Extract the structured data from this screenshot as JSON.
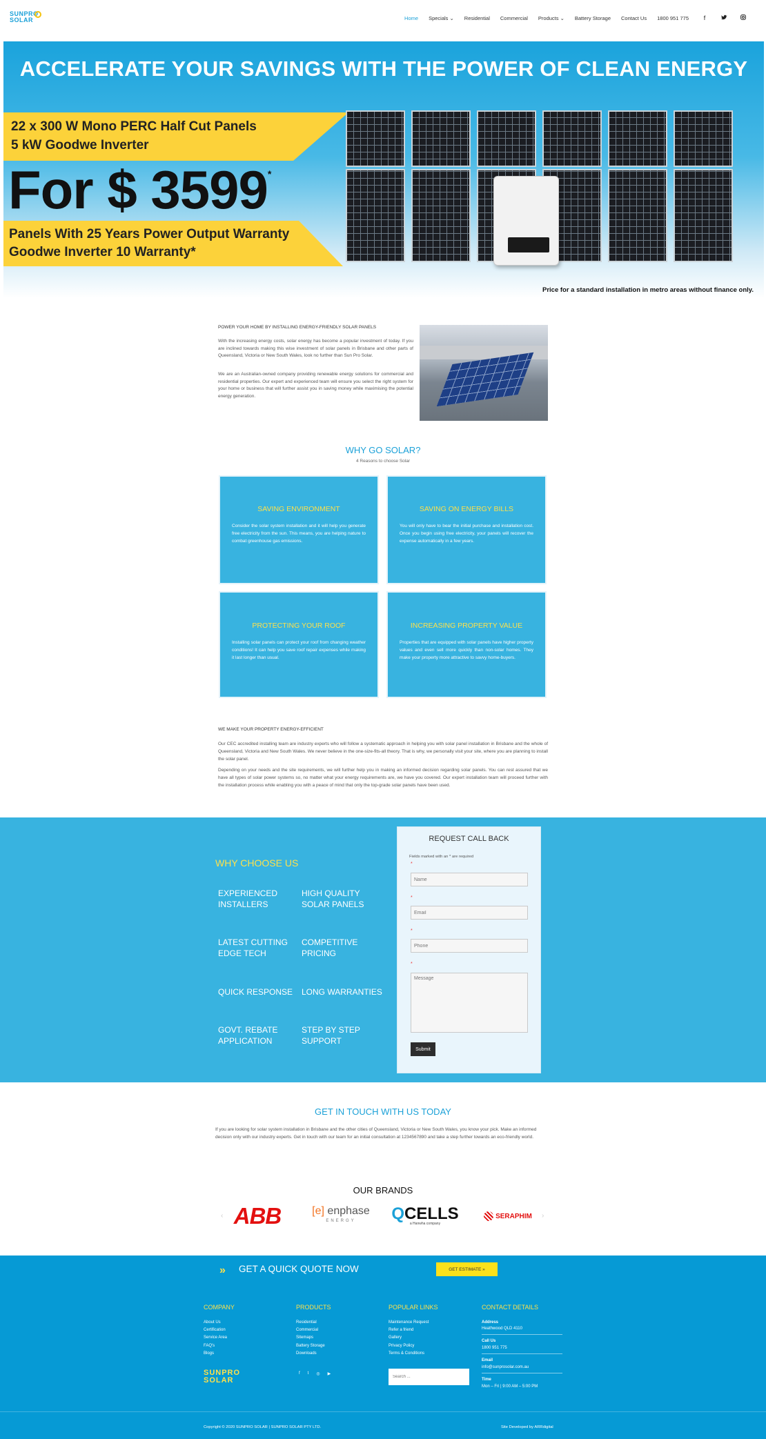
{
  "header": {
    "logo_line1": "SUNPRO",
    "logo_line2": "SOLAR",
    "nav": [
      "Home",
      "Specials ⌄",
      "Residential",
      "Commercial",
      "Products ⌄",
      "Battery Storage",
      "Contact Us",
      "1800 951 775"
    ],
    "social_icons": [
      "facebook-icon",
      "twitter-icon",
      "instagram-icon"
    ]
  },
  "hero": {
    "title": "ACCELERATE YOUR SAVINGS WITH THE POWER OF CLEAN ENERGY",
    "line1": "22 x 300 W  Mono PERC Half Cut Panels",
    "line2": "5 kW Goodwe Inverter",
    "price": "For $ 3599",
    "price_mark": "*",
    "warranty1": "Panels With 25 Years Power  Output Warranty",
    "warranty2": "Goodwe Inverter 10 Warranty*",
    "note": "Price for a standard installation in metro areas without finance only.",
    "accent_yellow": "#fcd23a"
  },
  "intro": {
    "heading": "POWER YOUR HOME BY INSTALLING ENERGY-FRIENDLY SOLAR PANELS",
    "p1": "With the increasing energy costs, solar energy has become a popular investment of today. If you are inclined towards making this wise investment of solar panels in Brisbane and other parts of Queensland, Victoria or New South Wales, look no further than Sun Pro Solar.",
    "p2": "We are an Australian-owned company providing renewable energy solutions for commercial and residential properties. Our expert and experienced team will ensure you select the right system for your home or business that will further assist you in saving money while maximising the potential energy generation."
  },
  "why_solar": {
    "title": "WHY GO SOLAR?",
    "subtitle": "4 Reasons to choose Solar",
    "cards": [
      {
        "title": "SAVING ENVIRONMENT",
        "body": "Consider the solar system installation and it will help you generate free electricity from the sun. This means, you are helping nature to combat greenhouse gas emissions."
      },
      {
        "title": "SAVING ON ENERGY BILLS",
        "body": "You will only have to bear the initial purchase and installation cost. Once you begin using free electricity, your panels will recover the expense automatically in a few years."
      },
      {
        "title": "PROTECTING YOUR ROOF",
        "body": "Installing solar panels can protect your roof from changing weather conditions! It can help you save roof repair expenses while making it last longer than usual."
      },
      {
        "title": "INCREASING PROPERTY VALUE",
        "body": "Properties that are equipped with solar panels have higher property values and even sell more quickly than non-solar homes. They make your property more attractive to savvy home-buyers."
      }
    ]
  },
  "efficient": {
    "heading": "WE MAKE YOUR PROPERTY ENERGY-EFFICIENT",
    "p1": "Our CEC accredited installing team are industry experts who will follow a systematic approach in helping you with solar panel installation in Brisbane and the whole of Queensland, Victoria and New South Wales. We never believe in the one-size-fits-all theory. That is why, we personally visit your site, where you are planning to install the solar panel.",
    "p2": "Depending on your needs and the site requirements, we will further help you in making an informed decision regarding solar panels. You can rest assured that we have all types of solar power systems so, no matter what your energy requirements are, we have you covered. Our expert installation team will proceed further with the installation process while enabling you with a peace of mind that only the top-grade solar panels have been used."
  },
  "choose": {
    "title": "WHY CHOOSE US",
    "features": [
      [
        "EXPERIENCED",
        "INSTALLERS"
      ],
      [
        "HIGH QUALITY",
        "SOLAR PANELS"
      ],
      [
        "LATEST CUTTING",
        "EDGE TECH"
      ],
      [
        "COMPETITIVE",
        "PRICING"
      ],
      [
        "QUICK RESPONSE",
        ""
      ],
      [
        "LONG WARRANTIES",
        ""
      ],
      [
        "GOVT. REBATE",
        "APPLICATION"
      ],
      [
        "STEP BY STEP",
        "SUPPORT"
      ]
    ],
    "bg": "#38b3e0"
  },
  "form": {
    "title": "REQUEST CALL BACK",
    "note": "Fields marked with an * are required",
    "required_mark": "*",
    "name_placeholder": "Name",
    "email_placeholder": "Email",
    "phone_placeholder": "Phone",
    "message_placeholder": "Message",
    "submit": "Submit"
  },
  "touch": {
    "title": "GET IN TOUCH WITH US TODAY",
    "body": "If you are looking for solar system installation in Brisbane and the other cities of Queensland, Victoria or New South Wales, you know your pick. Make an informed decision only with our industry experts. Get in touch with our team for an initial consultation at 1234567890 and take a step further towards an eco-friendly world."
  },
  "brands": {
    "title": "OUR BRANDS",
    "abb": "ABB",
    "enphase_e": "[e]",
    "enphase": "enphase",
    "enphase_sub": "ENERGY",
    "qcells_q": "Q",
    "qcells": "CELLS",
    "qcells_sub": "a Hanwha company",
    "seraphim": "SERAPHIM",
    "prev": "‹",
    "next": "›"
  },
  "footer": {
    "quote_icon": "»",
    "quote_title": "GET A QUICK QUOTE NOW",
    "estimate": "GET ESTIMATE  »",
    "company_h": "COMPANY",
    "company": [
      "About Us",
      "Certification",
      "Service Area",
      "FAQ's",
      "Blogs"
    ],
    "products_h": "PRODUCTS",
    "products": [
      "Residential",
      "Commercial",
      "Sitemaps",
      "Battery Storage",
      "Downloads"
    ],
    "popular_h": "POPULAR LINKS",
    "popular": [
      "Maintenance Request",
      "Refer a friend",
      "Gallery",
      "Privacy Policy",
      "Terms & Conditions"
    ],
    "contact_h": "CONTACT DETAILS",
    "address_label": "Address",
    "address": "Heathwood QLD 4110",
    "call_label": "Call Us",
    "phone": "1800 951 775",
    "email_label": "Email",
    "email": "info@sunprosolar.com.au",
    "time_label": "Time",
    "time": "Mon – Fri   |   9:00 AM – 5:00 PM",
    "logo_line1": "SUNPRO",
    "logo_line2": "SOLAR",
    "social": [
      "f",
      "t",
      "◎",
      "▶"
    ],
    "search_placeholder": "Search ...",
    "copyright": "Copyright © 2020 SUNPRO SOLAR | SUNPRO SOLAR PTY LTD.",
    "developer": "Site Developed by ARRdigital",
    "bg": "#069ad5"
  }
}
